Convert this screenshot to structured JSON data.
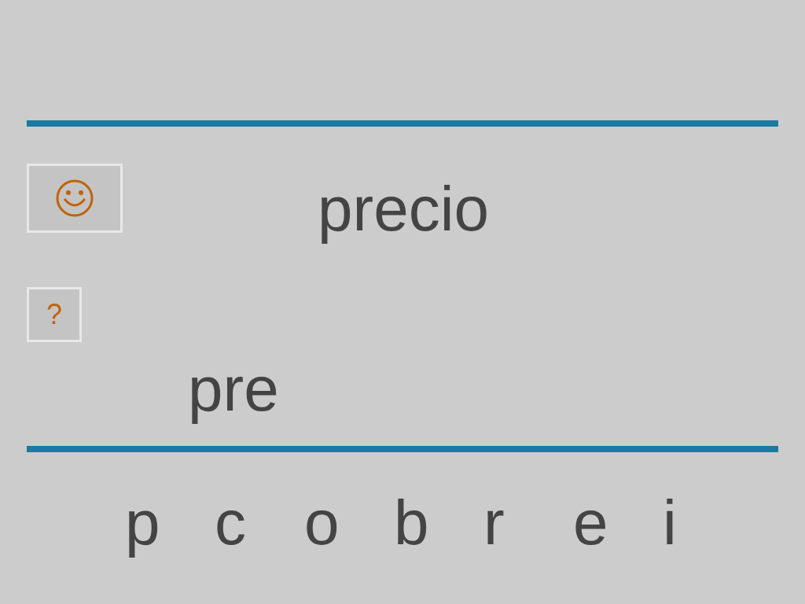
{
  "word": "precio",
  "hint_button": "?",
  "answer": "pre",
  "letters": [
    "p",
    "c",
    "o",
    "b",
    "r",
    "e",
    "i"
  ]
}
